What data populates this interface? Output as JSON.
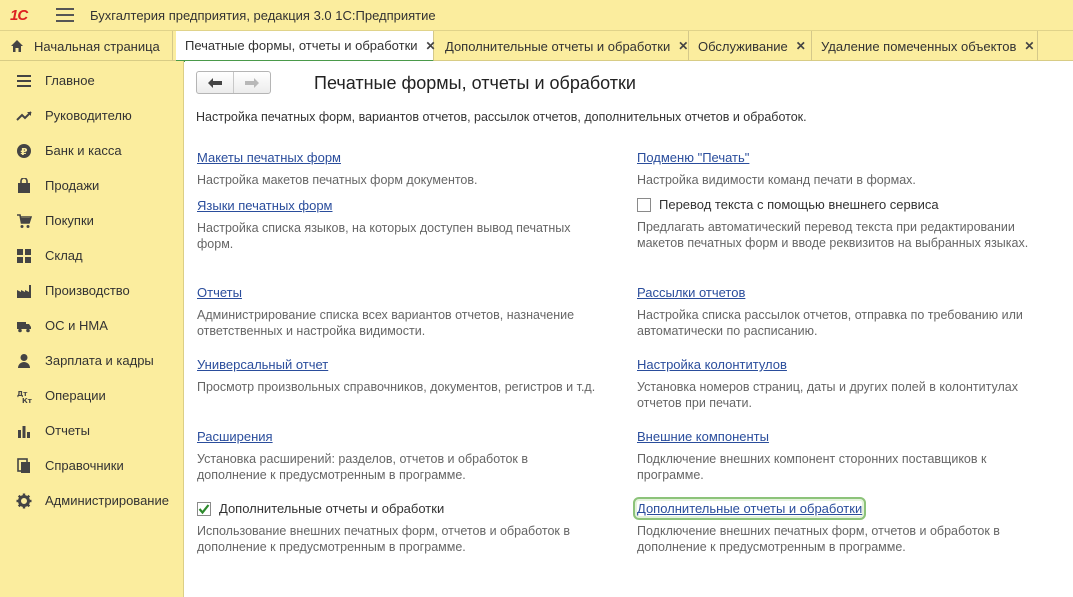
{
  "app": {
    "logo": "1С",
    "title": "Бухгалтерия предприятия, редакция 3.0 1С:Предприятие"
  },
  "tabs": [
    {
      "label": "Начальная страница"
    },
    {
      "label": "Печатные формы, отчеты и обработки"
    },
    {
      "label": "Дополнительные отчеты и обработки"
    },
    {
      "label": "Обслуживание"
    },
    {
      "label": "Удаление помеченных объектов"
    }
  ],
  "sidebar": {
    "items": [
      {
        "label": "Главное",
        "icon": "menu-lines-icon"
      },
      {
        "label": "Руководителю",
        "icon": "trend-icon"
      },
      {
        "label": "Банк и касса",
        "icon": "ruble-icon"
      },
      {
        "label": "Продажи",
        "icon": "bag-icon"
      },
      {
        "label": "Покупки",
        "icon": "cart-icon"
      },
      {
        "label": "Склад",
        "icon": "warehouse-icon"
      },
      {
        "label": "Производство",
        "icon": "factory-icon"
      },
      {
        "label": "ОС и НМА",
        "icon": "truck-icon"
      },
      {
        "label": "Зарплата и кадры",
        "icon": "person-icon"
      },
      {
        "label": "Операции",
        "icon": "dt-kt-icon"
      },
      {
        "label": "Отчеты",
        "icon": "bar-chart-icon"
      },
      {
        "label": "Справочники",
        "icon": "books-icon"
      },
      {
        "label": "Администрирование",
        "icon": "gear-icon"
      }
    ]
  },
  "main": {
    "title": "Печатные формы, отчеты и обработки",
    "description": "Настройка печатных форм, вариантов отчетов, рассылок отчетов, дополнительных отчетов и обработок.",
    "left": {
      "templates": {
        "link": "Макеты печатных форм",
        "hint": "Настройка макетов печатных форм документов."
      },
      "languages": {
        "link": "Языки печатных форм",
        "hint": "Настройка списка языков, на которых доступен вывод печатных форм."
      },
      "reports": {
        "link": "Отчеты",
        "hint": "Администрирование списка всех вариантов отчетов, назначение ответственных и настройка видимости."
      },
      "universal": {
        "link": "Универсальный отчет",
        "hint": "Просмотр произвольных справочников, документов, регистров и т.д."
      },
      "extensions": {
        "link": "Расширения",
        "hint": "Установка расширений: разделов, отчетов и обработок в дополнение к предусмотренным в программе."
      },
      "additional": {
        "label": "Дополнительные отчеты и обработки",
        "checked": true,
        "hint": "Использование внешних печатных форм, отчетов и обработок в дополнение к предусмотренным в программе."
      }
    },
    "right": {
      "submenu": {
        "link": "Подменю \"Печать\"",
        "hint": "Настройка видимости команд печати в формах."
      },
      "translation": {
        "label": "Перевод текста с помощью внешнего сервиса",
        "checked": false,
        "hint": "Предлагать автоматический перевод текста при редактировании макетов печатных форм и вводе реквизитов на выбранных языках."
      },
      "mailings": {
        "link": "Рассылки отчетов",
        "hint": "Настройка списка рассылок отчетов, отправка по требованию или автоматически по расписанию."
      },
      "headers": {
        "link": "Настройка колонтитулов",
        "hint": "Установка номеров страниц, даты и других полей в колонтитулах отчетов при печати."
      },
      "components": {
        "link": "Внешние компоненты",
        "hint": "Подключение внешних компонент сторонних поставщиков к программе."
      },
      "additional": {
        "link": "Дополнительные отчеты и обработки",
        "hint": "Подключение внешних печатных форм, отчетов и обработок в дополнение к предусмотренным в программе."
      }
    }
  }
}
